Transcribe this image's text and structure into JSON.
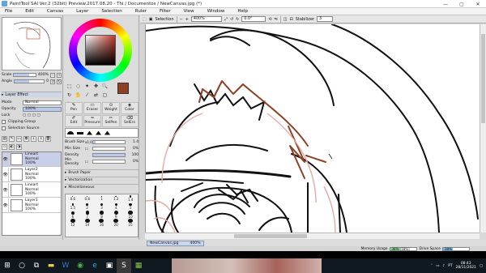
{
  "window": {
    "title": "PaintTool SAI Ver.2 (32bit) Preview.2017.08.20 - Thi / Documentos / NewCanvas.jpg (*)",
    "minimize": "—",
    "maximize": "▢",
    "close": "✕"
  },
  "menu": [
    "File",
    "Edit",
    "Canvas",
    "Layer",
    "Selection",
    "Ruler",
    "Filter",
    "View",
    "Window",
    "Help"
  ],
  "navigator": {
    "zoom_label": "Scale",
    "zoom_value": "400%",
    "angle_label": "Angle",
    "angle_value": "0"
  },
  "layer_panel": {
    "header": "Layer Effect",
    "mode_label": "Mode",
    "mode_value": "Normal",
    "opacity_label": "Opacity",
    "opacity_value": "100%",
    "lock_label": "Lock",
    "clipping_label": "Clipping Group",
    "selection_source_label": "Selection Source",
    "layers": [
      {
        "name": "Lineart",
        "mode": "Normal",
        "opacity": "100%",
        "selected": true
      },
      {
        "name": "Layer2",
        "mode": "Normal",
        "opacity": "100%",
        "selected": false
      },
      {
        "name": "Lineart",
        "mode": "Normal",
        "opacity": "100%",
        "selected": false
      },
      {
        "name": "Layer1",
        "mode": "Normal",
        "opacity": "100%",
        "selected": false
      }
    ]
  },
  "color": {
    "current": "#8e4024",
    "opacity_fraction": 1.0
  },
  "tools": [
    {
      "label": "Pen",
      "icon": "pen-icon"
    },
    {
      "label": "Eraser",
      "icon": "eraser-icon"
    },
    {
      "label": "Weight",
      "icon": "weight-icon"
    },
    {
      "label": "Color",
      "icon": "color-icon"
    },
    {
      "label": "Edit",
      "icon": "edit-icon"
    },
    {
      "label": "Pressure",
      "icon": "pressure-icon"
    },
    {
      "label": "SelPen",
      "icon": "selpen-icon"
    },
    {
      "label": "SelErs",
      "icon": "selers-icon"
    }
  ],
  "brush": {
    "size_label": "Brush Size",
    "size_mult": "x1.0",
    "size_value": "1.4",
    "size_fraction": 0.08,
    "min_size_label": "Min Size",
    "min_size_value": "0%",
    "min_size_fraction": 0.0,
    "density_label": "Density",
    "density_value": "100",
    "density_fraction": 1.0,
    "min_density_label": "Min Density",
    "min_density_value": "0%",
    "min_density_fraction": 0.0,
    "sections": [
      "Brush Paper",
      "Vectorization",
      "Miscellaneous"
    ]
  },
  "size_presets": [
    "0.6",
    "0.8",
    "1",
    "1.2",
    "1.4",
    "1.5",
    "2",
    "3",
    "4",
    "5",
    "6",
    "7",
    "8",
    "9",
    "10",
    "12",
    "14",
    "16",
    "20",
    "25"
  ],
  "canvas_toolbar": {
    "selection_label": "Selection",
    "zoom": "400%",
    "rotation": "0.0°",
    "stabilizer_label": "Stabilizer",
    "stabilizer_value": "3"
  },
  "doc_tab": {
    "name": "NewCanvas.jpg",
    "zoom": "400%"
  },
  "status": {
    "memory_label": "Memory Usage",
    "memory_text": "38% (18%)",
    "memory_fraction": 0.38,
    "drive_label": "Drive Space",
    "drive_text": "38%",
    "drive_fraction": 0.38
  },
  "taskbar": {
    "apps": [
      "windows-start-icon",
      "search-icon",
      "task-view-icon",
      "file-explorer-icon",
      "word-icon",
      "chrome-icon",
      "edge-icon",
      "store-icon",
      "sai-icon",
      "photos-icon"
    ],
    "language": "PT",
    "time": "08:43",
    "date": "28/11/2021"
  }
}
